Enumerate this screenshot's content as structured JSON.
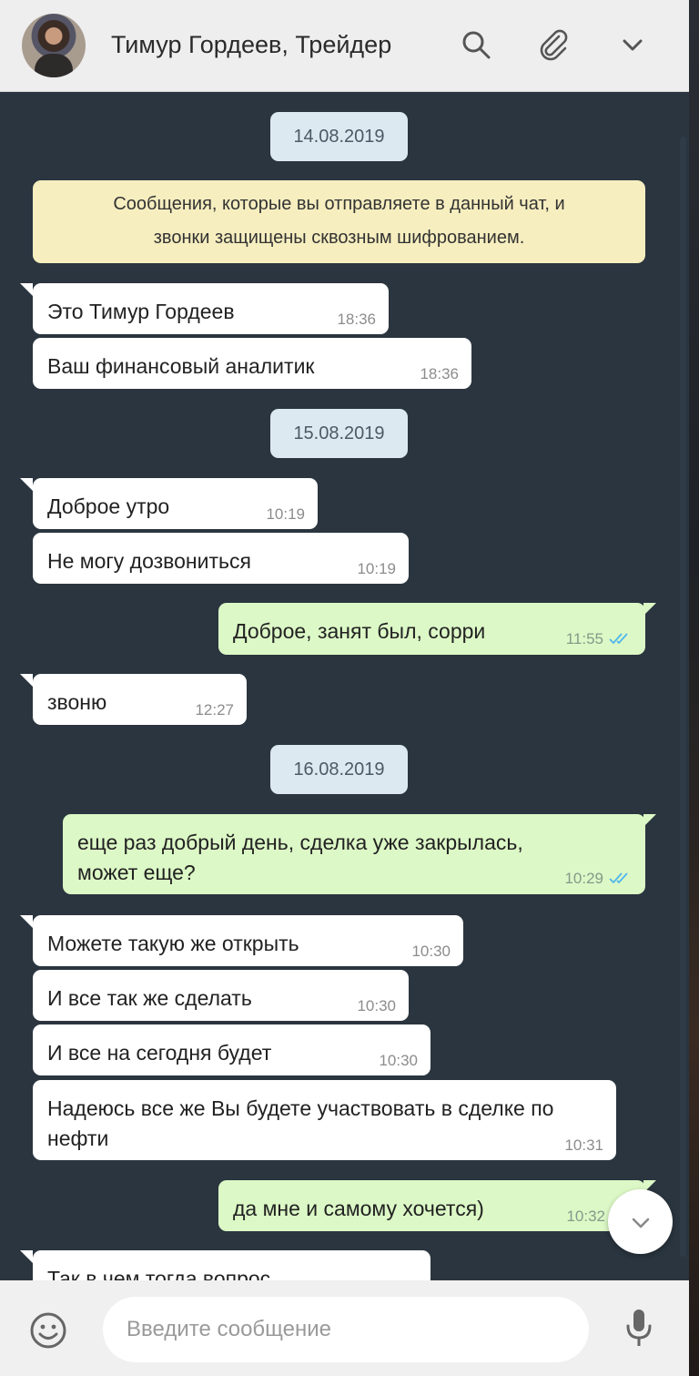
{
  "header": {
    "contact_name": "Тимур Гордеев, Трейдер",
    "icons": [
      "search-icon",
      "paperclip-icon",
      "chevron-down-icon"
    ]
  },
  "chat": {
    "dates": [
      "14.08.2019",
      "15.08.2019",
      "16.08.2019"
    ],
    "encryption_notice": {
      "line1": "Сообщения, которые вы отправляете в данный чат, и",
      "line2": "звонки защищены сквозным шифрованием."
    },
    "messages": [
      {
        "direction": "in",
        "text": "Это Тимур Гордеев",
        "time": "18:36"
      },
      {
        "direction": "in",
        "text": "Ваш финансовый аналитик",
        "time": "18:36"
      },
      {
        "direction": "in",
        "text": "Доброе утро",
        "time": "10:19"
      },
      {
        "direction": "in",
        "text": "Не могу дозвониться",
        "time": "10:19"
      },
      {
        "direction": "out",
        "text": "Доброе, занят был, сорри",
        "time": "11:55",
        "status": "read"
      },
      {
        "direction": "in",
        "text": "звоню",
        "time": "12:27"
      },
      {
        "direction": "out",
        "text": "еще раз добрый день, сделка уже закрылась, может еще?",
        "time": "10:29",
        "status": "read"
      },
      {
        "direction": "in",
        "text": "Можете такую же открыть",
        "time": "10:30"
      },
      {
        "direction": "in",
        "text": "И все так же сделать",
        "time": "10:30"
      },
      {
        "direction": "in",
        "text": "И все на сегодня будет",
        "time": "10:30"
      },
      {
        "direction": "in",
        "text": "Надеюсь все же Вы будете участвовать в сделке по нефти",
        "time": "10:31"
      },
      {
        "direction": "out",
        "text": "да мне и самому хочется)",
        "time": "10:32",
        "status": "read"
      },
      {
        "direction": "in",
        "text": "Так в чем тогда вопрос",
        "time": ""
      }
    ]
  },
  "composer": {
    "placeholder": "Введите сообщение",
    "icons": [
      "emoji-icon",
      "microphone-icon"
    ]
  },
  "colors": {
    "chat_background": "#2a353f",
    "incoming_bubble": "#ffffff",
    "outgoing_bubble": "#dcf8c6",
    "date_pill": "#dde9f0",
    "notice": "#f6eebf",
    "read_ticks": "#4fb6ec"
  }
}
